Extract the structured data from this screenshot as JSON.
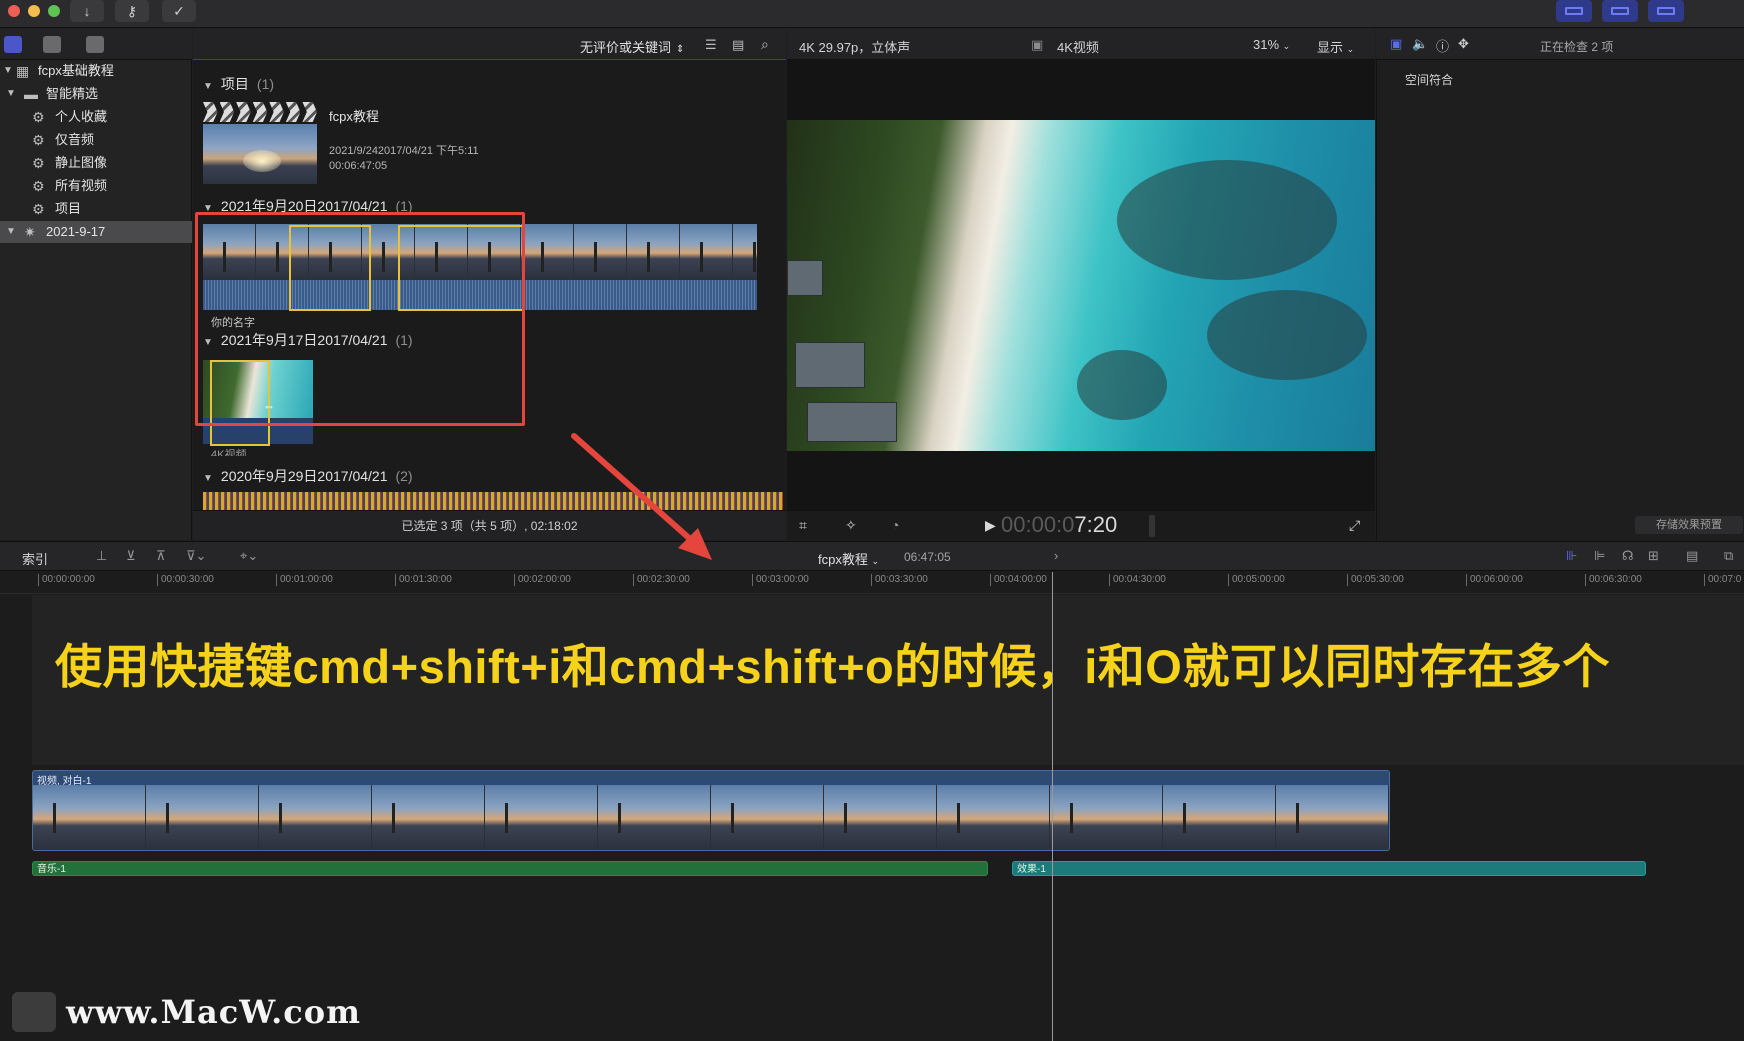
{
  "colors": {
    "caption": "#f6d21a",
    "annotation_box": "#e4453c",
    "range_box": "#e9c23a",
    "video_clip": "#2d4a74",
    "music_clip": "#23713a",
    "effect_clip": "#1d7a7a"
  },
  "sidebar": {
    "library": "fcpx基础教程",
    "smart_folder": "智能精选",
    "items": [
      "个人收藏",
      "仅音频",
      "静止图像",
      "所有视频",
      "项目"
    ],
    "event": "2021-9-17"
  },
  "browser": {
    "filter_label": "无评价或关键词",
    "groups": [
      {
        "title": "项目",
        "count": "(1)"
      },
      {
        "title": "2021年9月20日2017/04/21",
        "count": "(1)"
      },
      {
        "title": "2021年9月17日2017/04/21",
        "count": "(1)"
      },
      {
        "title": "2020年9月29日2017/04/21",
        "count": "(2)"
      }
    ],
    "project": {
      "name": "fcpx教程",
      "date": "2021/9/242017/04/21 下午5:11",
      "duration": "00:06:47:05"
    },
    "clip_label_1": "你的名字",
    "clip_label_2": "4K视频",
    "footer": "已选定 3 项（共 5 项）, 02:18:02"
  },
  "viewer": {
    "format": "4K 29.97p，立体声",
    "title": "4K视频",
    "zoom": "31%",
    "display": "显示",
    "timecode_dim": "00:00:0",
    "timecode": "7:20"
  },
  "inspector": {
    "status": "正在检查 2 项",
    "field": "空间符合",
    "save_preset": "存储效果预置"
  },
  "timeline": {
    "index_label": "索引",
    "project": "fcpx教程",
    "duration": "06:47:05",
    "ruler": [
      "00:00:00:00",
      "00:00:30:00",
      "00:01:00:00",
      "00:01:30:00",
      "00:02:00:00",
      "00:02:30:00",
      "00:03:00:00",
      "00:03:30:00",
      "00:04:00:00",
      "00:04:30:00",
      "00:05:00:00",
      "00:05:30:00",
      "00:06:00:00",
      "00:06:30:00",
      "00:07:0"
    ],
    "video_clip": "视频, 对白-1",
    "music_clip": "音乐-1",
    "effect_clip": "效果-1"
  },
  "caption": "使用快捷键cmd+shift+i和cmd+shift+o的时候，i和O就可以同时存在多个",
  "watermark": "www.MacW.com"
}
